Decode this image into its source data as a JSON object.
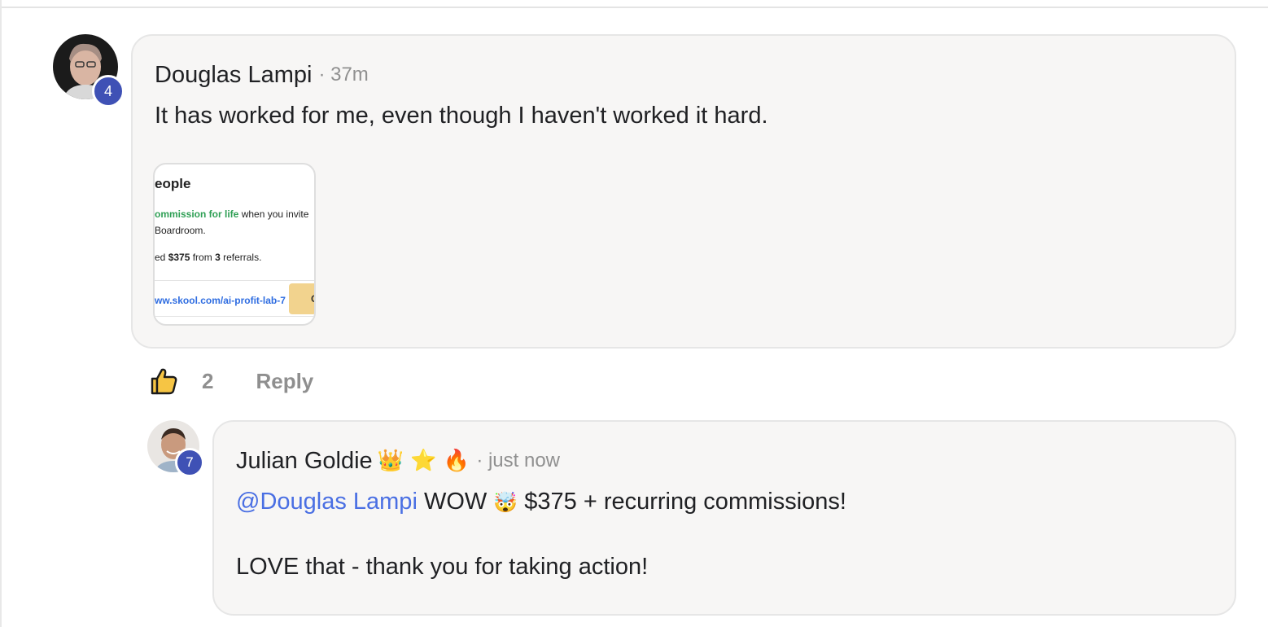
{
  "colors": {
    "bubble_bg": "#f7f6f5",
    "badge": "#3f51b5",
    "mention": "#4a6fe3",
    "muted": "#8f8f8f"
  },
  "comment": {
    "author": "Douglas Lampi",
    "time": "· 37m",
    "level": "4",
    "text": "It has worked for me, even though I haven't worked it hard.",
    "attachment": {
      "title": "eople",
      "line1_green": "ommission for life",
      "line1_rest": " when you invite",
      "line2": "Boardroom.",
      "line3_pre": "ed ",
      "line3_amount": "$375",
      "line3_mid": " from ",
      "line3_count": "3",
      "line3_post": " referrals.",
      "link": "ww.skool.com/ai-profit-lab-7",
      "button": "C"
    },
    "likes": "2",
    "reply_label": "Reply",
    "like_icon": "thumbs-up-icon"
  },
  "reply": {
    "author": "Julian Goldie",
    "author_emojis": "👑 ⭐ 🔥",
    "time": "· just now",
    "level": "7",
    "mention": "@Douglas Lampi",
    "line1_a": " WOW ",
    "line1_emoji": "🤯",
    "line1_b": " $375 + recurring commissions!",
    "line2": "LOVE that - thank you for taking action!"
  }
}
